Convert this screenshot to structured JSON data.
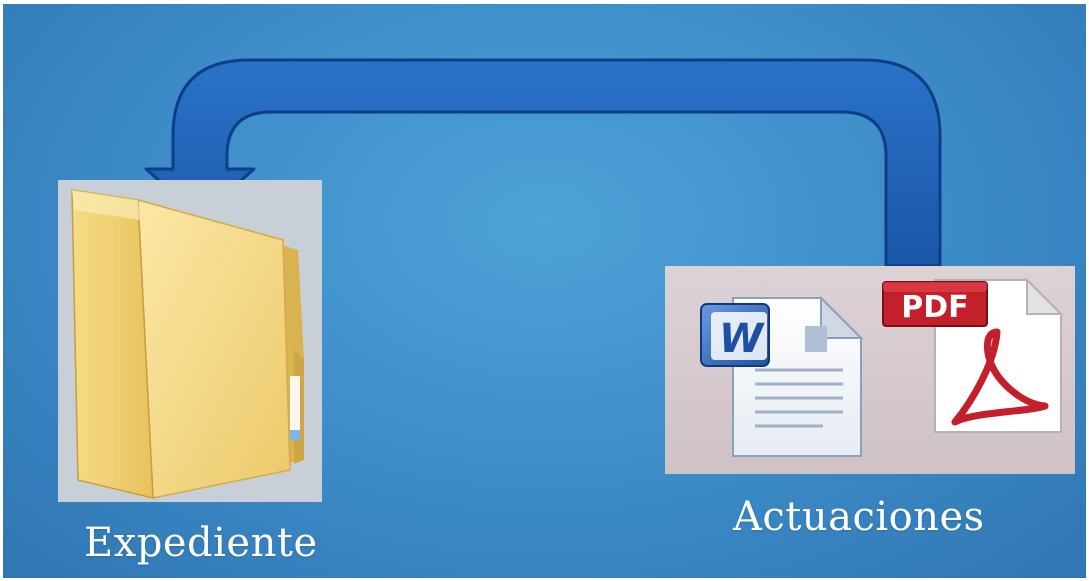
{
  "nodes": {
    "expediente": {
      "label": "Expediente",
      "icon": "folder-icon"
    },
    "actuaciones": {
      "label": "Actuaciones",
      "icons": [
        "word-document-icon",
        "pdf-document-icon"
      ],
      "pdf_badge": "PDF",
      "word_badge": "W"
    }
  },
  "edges": [
    {
      "from": "actuaciones",
      "to": "expediente",
      "style": "curved-arrow"
    }
  ],
  "colors": {
    "background": "#3f8fca",
    "arrow_fill": "#1f5fb4",
    "arrow_stroke": "#0e3f86",
    "folder": "#f2d478",
    "pdf_red": "#c4202b"
  }
}
